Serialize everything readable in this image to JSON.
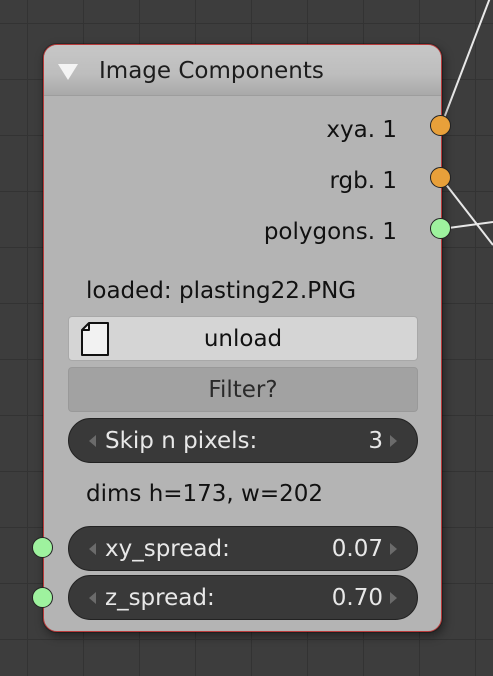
{
  "node": {
    "title": "Image Components",
    "outputs": [
      {
        "label": "xya. 1",
        "socket_color": "#e8a03a",
        "socket_type": "orange"
      },
      {
        "label": "rgb. 1",
        "socket_color": "#e8a03a",
        "socket_type": "orange"
      },
      {
        "label": "polygons. 1",
        "socket_color": "#9ef29e",
        "socket_type": "green"
      }
    ],
    "loaded_text": "loaded: plasting22.PNG",
    "unload_button": {
      "label": "unload",
      "icon": "file-icon"
    },
    "filter_button": {
      "label": "Filter?"
    },
    "skip_field": {
      "label": "Skip n pixels:",
      "value": "3"
    },
    "dims_text": "dims h=173, w=202",
    "inputs": [
      {
        "label": "xy_spread:",
        "value": "0.07",
        "socket_color": "#9ef29e"
      },
      {
        "label": "z_spread:",
        "value": "0.70",
        "socket_color": "#9ef29e"
      }
    ],
    "header_icon": "collapse-triangle-icon",
    "frame_color": "#b83a3a"
  }
}
